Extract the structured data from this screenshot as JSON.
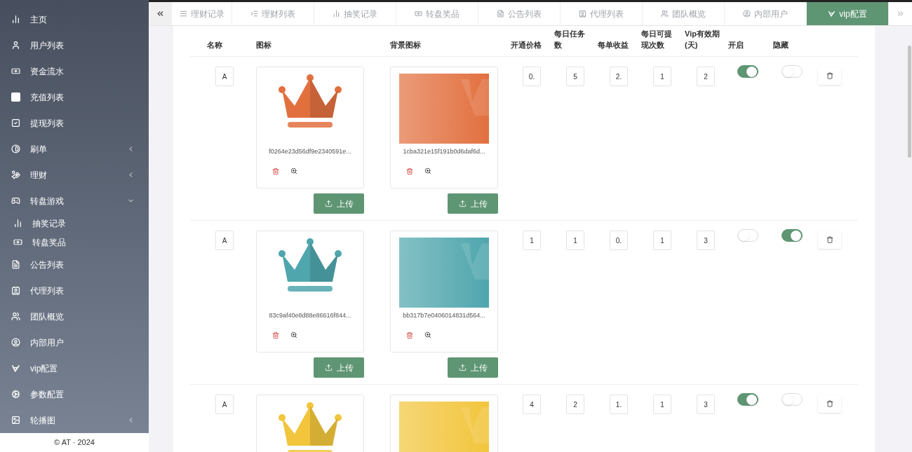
{
  "sidebar": {
    "items": [
      {
        "label": "主页"
      },
      {
        "label": "用户列表"
      },
      {
        "label": "资金流水"
      },
      {
        "label": "充值列表"
      },
      {
        "label": "提现列表"
      },
      {
        "label": "刷单",
        "expanded": false
      },
      {
        "label": "理财",
        "expanded": false
      },
      {
        "label": "转盘游戏",
        "expanded": true,
        "children": [
          {
            "label": "抽奖记录"
          },
          {
            "label": "转盘奖品"
          }
        ]
      },
      {
        "label": "公告列表"
      },
      {
        "label": "代理列表"
      },
      {
        "label": "团队概览"
      },
      {
        "label": "内部用户"
      },
      {
        "label": "vip配置"
      },
      {
        "label": "参数配置"
      },
      {
        "label": "轮播图",
        "expanded": false
      }
    ],
    "footer": "© AT · 2024"
  },
  "tabs": [
    {
      "label": "理财记录",
      "selected": false
    },
    {
      "label": "理财列表",
      "selected": false
    },
    {
      "label": "抽奖记录",
      "selected": false
    },
    {
      "label": "转盘奖品",
      "selected": false
    },
    {
      "label": "公告列表",
      "selected": false
    },
    {
      "label": "代理列表",
      "selected": false
    },
    {
      "label": "团队概览",
      "selected": false
    },
    {
      "label": "内部用户",
      "selected": false
    },
    {
      "label": "vip配置",
      "selected": true
    }
  ],
  "table": {
    "columns": [
      "名称",
      "图标",
      "背景图标",
      "开通价格",
      "每日任务数",
      "每单收益",
      "每日可提现次数",
      "Vip有效期(天)",
      "开启",
      "隐藏"
    ],
    "rows": [
      {
        "name": "A",
        "color": "#e2703f",
        "icon_file": "f0264e23d56df9e2340591e...",
        "icon_upload": "上传",
        "bg_file": "1cba321e15f191b0d6daf6d...",
        "bg_upload": "上传",
        "price": "0.",
        "tasks": "5",
        "income": "2.",
        "withdrawals": "1",
        "days": "2",
        "enabled": true,
        "hidden": false
      },
      {
        "name": "A",
        "color": "#4fa6ad",
        "icon_file": "83c9af40e8d88e86616f844...",
        "icon_upload": "上传",
        "bg_file": "bb317b7e0406014831d564...",
        "bg_upload": "上传",
        "price": "1",
        "tasks": "1",
        "income": "0.",
        "withdrawals": "1",
        "days": "3",
        "enabled": false,
        "hidden": true
      },
      {
        "name": "A",
        "color": "#f2c53c",
        "price": "4",
        "tasks": "2",
        "income": "1.",
        "withdrawals": "1",
        "days": "3",
        "enabled": true,
        "hidden": false
      }
    ]
  }
}
